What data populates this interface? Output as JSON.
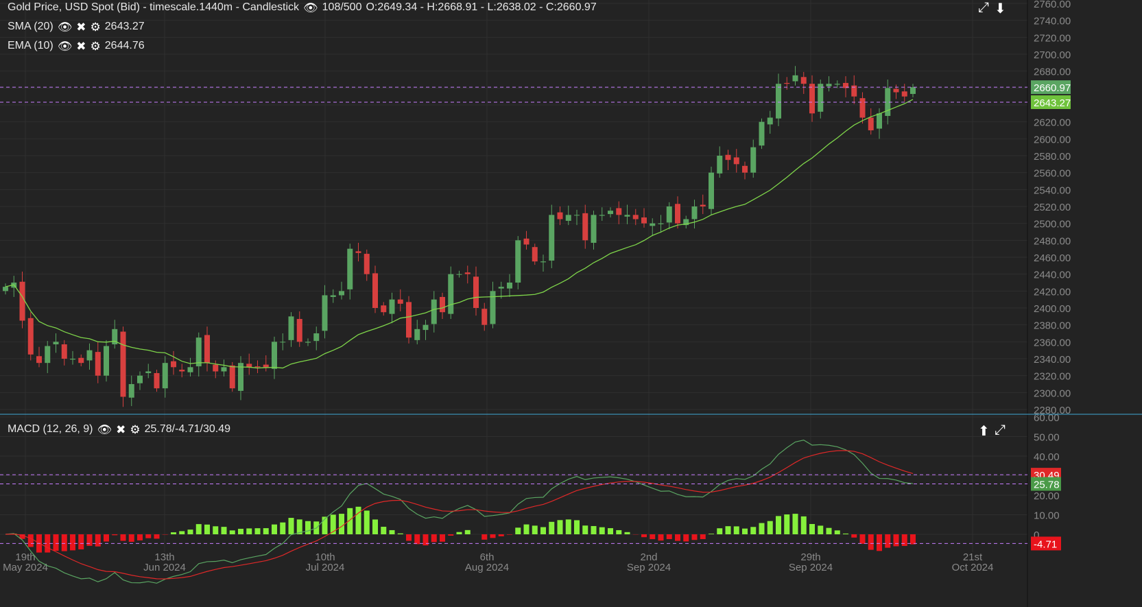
{
  "header": {
    "title": "Gold Price, USD Spot (Bid) - timescale.1440m - Candlestick",
    "count": "108/500",
    "ohlc": "O:2649.34 - H:2668.91 - L:2638.02 - C:2660.97"
  },
  "indicators": [
    {
      "label": "SMA (20)",
      "value": "2643.27"
    },
    {
      "label": "EMA (10)",
      "value": "2644.76"
    }
  ],
  "macd": {
    "label": "MACD (12, 26, 9)",
    "value": "25.78/-4.71/30.49",
    "badges": {
      "signal": "30.49",
      "macd": "25.78",
      "hist": "-4.71"
    }
  },
  "price_badges": {
    "last": "2660.97",
    "sma": "2643.27"
  },
  "price_axis": [
    "2760.00",
    "2740.00",
    "2720.00",
    "2700.00",
    "2680.00",
    "2660.00",
    "2640.00",
    "2620.00",
    "2600.00",
    "2580.00",
    "2560.00",
    "2540.00",
    "2520.00",
    "2500.00",
    "2480.00",
    "2460.00",
    "2440.00",
    "2420.00",
    "2400.00",
    "2380.00",
    "2360.00",
    "2340.00",
    "2320.00",
    "2300.00",
    "2280.00"
  ],
  "macd_axis": [
    "60.00",
    "50.00",
    "40.00",
    "30.00",
    "20.00",
    "10.00",
    "0"
  ],
  "x_axis": [
    {
      "day": "19th",
      "month": "May 2024"
    },
    {
      "day": "13th",
      "month": "Jun 2024"
    },
    {
      "day": "10th",
      "month": "Jul 2024"
    },
    {
      "day": "6th",
      "month": "Aug 2024"
    },
    {
      "day": "2nd",
      "month": "Sep 2024"
    },
    {
      "day": "29th",
      "month": "Sep 2024"
    },
    {
      "day": "21st",
      "month": "Oct 2024"
    }
  ],
  "colors": {
    "up": "#5aa562",
    "down": "#d8403f",
    "sma": "#7fd64a",
    "signal": "#e02828",
    "macdline": "#5aa562",
    "histUp": "#86f03c",
    "histDown": "#e8141c",
    "guide": "#c77dff"
  },
  "chart_data": {
    "type": "candlestick",
    "closes": [
      2425,
      2430,
      2385,
      2345,
      2335,
      2355,
      2360,
      2340,
      2340,
      2335,
      2350,
      2320,
      2355,
      2375,
      2295,
      2310,
      2320,
      2325,
      2305,
      2335,
      2330,
      2325,
      2330,
      2365,
      2335,
      2325,
      2330,
      2305,
      2335,
      2330,
      2330,
      2330,
      2360,
      2360,
      2390,
      2360,
      2360,
      2370,
      2415,
      2415,
      2420,
      2470,
      2465,
      2440,
      2400,
      2395,
      2410,
      2405,
      2365,
      2375,
      2380,
      2410,
      2395,
      2440,
      2440,
      2440,
      2400,
      2380,
      2420,
      2425,
      2430,
      2480,
      2475,
      2455,
      2455,
      2510,
      2505,
      2510,
      2510,
      2480,
      2510,
      2510,
      2515,
      2510,
      2510,
      2505,
      2500,
      2500,
      2500,
      2520,
      2500,
      2505,
      2520,
      2520,
      2560,
      2580,
      2575,
      2570,
      2560,
      2590,
      2620,
      2625,
      2665,
      2665,
      2675,
      2665,
      2630,
      2665,
      2665,
      2665,
      2660,
      2650,
      2625,
      2610,
      2630,
      2660,
      2655,
      2650,
      2660.97
    ],
    "price_range": [
      2280,
      2760
    ],
    "macd_range": [
      -8,
      60
    ]
  }
}
